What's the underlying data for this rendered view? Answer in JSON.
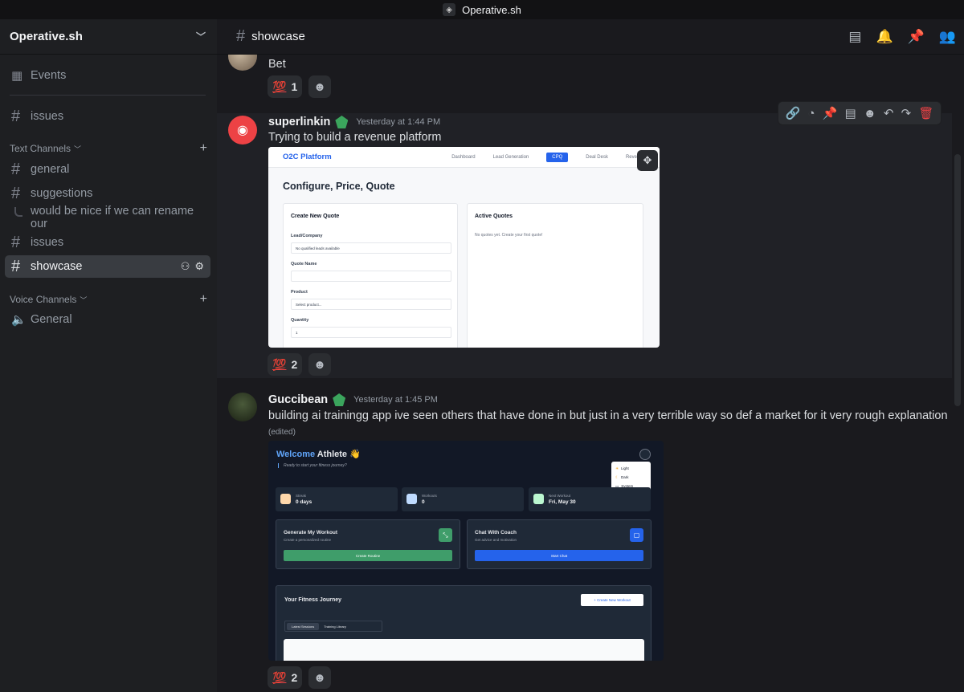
{
  "titlebar": {
    "title": "Operative.sh"
  },
  "server": {
    "name": "Operative.sh"
  },
  "sidebar": {
    "events_label": "Events",
    "top_channel": "issues",
    "text_category": "Text Channels",
    "voice_category": "Voice Channels",
    "channels": [
      "general",
      "suggestions",
      "issues",
      "showcase"
    ],
    "thread": "would be nice if we can rename our",
    "voice_channels": [
      "General"
    ]
  },
  "channel": {
    "name": "showcase"
  },
  "messages": [
    {
      "text": "Bet",
      "reaction": {
        "emoji": "💯",
        "count": "1"
      }
    },
    {
      "author": "superlinkin",
      "timestamp": "Yesterday at 1:44 PM",
      "text": "Trying to build a revenue platform",
      "reaction": {
        "emoji": "💯",
        "count": "2"
      },
      "attachment": {
        "brand": "O2C Platform",
        "nav": [
          "Dashboard",
          "Lead Generation",
          "CPQ",
          "Deal Desk",
          "Revenue"
        ],
        "heading": "Configure, Price, Quote",
        "create_title": "Create New Quote",
        "lead_label": "Lead/Company",
        "lead_value": "No qualified leads available",
        "quote_name_label": "Quote Name",
        "product_label": "Product",
        "product_value": "Select product...",
        "quantity_label": "Quantity",
        "quantity_value": "1",
        "active_title": "Active Quotes",
        "active_empty": "No quotes yet. Create your first quote!"
      }
    },
    {
      "author": "Guccibean",
      "timestamp": "Yesterday at 1:45 PM",
      "text": "building ai trainingg app  ive seen others that have done in but just in a very terrible way so def a market for it very rough explanation",
      "edited": "(edited)",
      "reaction": {
        "emoji": "💯",
        "count": "2"
      },
      "attachment": {
        "welcome_1": "Welcome",
        "welcome_2": "Athlete 👋",
        "subtitle": "Ready to start your fitness journey?",
        "theme_options": [
          "Light",
          "Dark",
          "System"
        ],
        "stats": [
          {
            "label": "Streak",
            "value": "0 days"
          },
          {
            "label": "Workouts",
            "value": "0"
          },
          {
            "label": "Next Workout",
            "value": "Fri, May 30"
          }
        ],
        "gen_title": "Generate My Workout",
        "gen_sub": "Create a personalized routine",
        "gen_btn": "Create Routine",
        "chat_title": "Chat With Coach",
        "chat_sub": "Get advice and motivation",
        "chat_btn": "Start Chat",
        "journey_title": "Your Fitness Journey",
        "journey_btn": "+ Create New Workout",
        "tabs": [
          "Latest Sessions",
          "Training Library"
        ]
      }
    }
  ],
  "colors": {
    "accent": "#5865f2",
    "reaction_bg": "#2b2d31",
    "danger": "#ed4245"
  }
}
